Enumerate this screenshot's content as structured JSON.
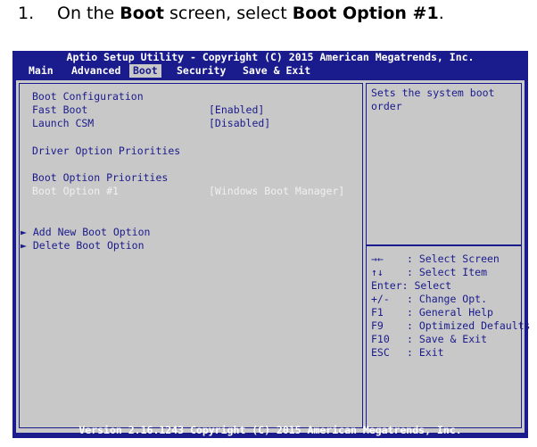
{
  "instruction": {
    "number": "1.",
    "part1": "On the ",
    "bold1": "Boot",
    "part2": " screen, select ",
    "bold2": "Boot Option #1",
    "part3": "."
  },
  "bios": {
    "title": "Aptio Setup Utility - Copyright (C) 2015 American Megatrends, Inc.",
    "menu": [
      "Main",
      "Advanced",
      "Boot",
      "Security",
      "Save & Exit"
    ],
    "active_menu": "Boot",
    "left": {
      "boot_configuration": "Boot Configuration",
      "fast_boot_label": "Fast Boot",
      "fast_boot_value": "[Enabled]",
      "launch_csm_label": "Launch CSM",
      "launch_csm_value": "[Disabled]",
      "driver_option_priorities": "Driver Option Priorities",
      "boot_option_priorities": "Boot Option Priorities",
      "boot_option_1_label": "Boot Option #1",
      "boot_option_1_value": "[Windows Boot Manager]",
      "add_new_boot_option": "Add New Boot Option",
      "delete_boot_option": "Delete Boot Option",
      "submenu_arrow": "►"
    },
    "help": "Sets the system boot\norder",
    "keys": [
      {
        "key": "→←",
        "desc": ": Select Screen"
      },
      {
        "key": "↑↓",
        "desc": ": Select Item"
      },
      {
        "key": "Enter:",
        "desc": "Select"
      },
      {
        "key": "+/-",
        "desc": ": Change Opt."
      },
      {
        "key": "F1",
        "desc": ": General Help"
      },
      {
        "key": "F9",
        "desc": ": Optimized Defaults"
      },
      {
        "key": "F10",
        "desc": ": Save & Exit"
      },
      {
        "key": "ESC",
        "desc": ": Exit"
      }
    ],
    "footer": "Version 2.16.1243 Copyright (C) 2015 American Megatrends, Inc."
  }
}
